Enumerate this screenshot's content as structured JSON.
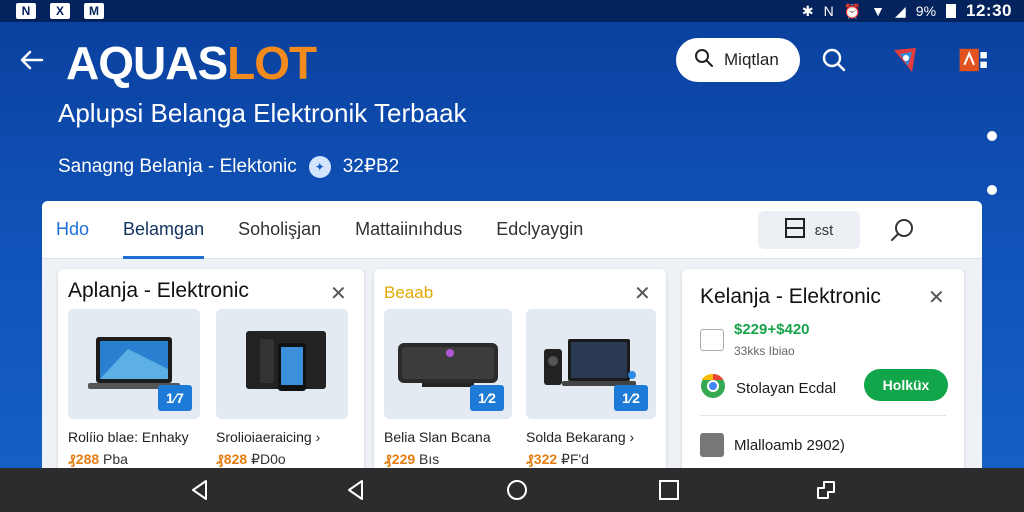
{
  "status_bar": {
    "left_icons": [
      "N",
      "X",
      "M"
    ],
    "battery": "9%",
    "time": "12:30"
  },
  "header": {
    "logo_part1": "AQUAS",
    "logo_part2": "LOT",
    "search_label": "Miqtlan",
    "headline": "Aplupsi Belanga Elektronik Terbaak",
    "subline": "Sanagng Belanja - Elektonic",
    "sub_badge_text": "32₽B2"
  },
  "tabs": {
    "items": [
      "Hdo",
      "Belamgan",
      "Soholişjan",
      "Mattaiinıhdus",
      "Edclyaygin"
    ],
    "filter_label": "ɛst"
  },
  "card1": {
    "title": "Aplanja - Elektronic",
    "products": [
      {
        "name": "Rolíio blae: Enhaky",
        "price": "₰288",
        "unit": "Pba",
        "qty": "1⁄7"
      },
      {
        "name": "Srolioiaeraicing",
        "price": "₰828",
        "unit": "₽D0o",
        "qty": ""
      }
    ]
  },
  "card2": {
    "title": "Beaab",
    "products": [
      {
        "name": "Belia Slan Bcana",
        "price": "₰229",
        "unit": "Bıs",
        "qty": "1⁄2"
      },
      {
        "name": "Solda Bekarang",
        "price": "₰322",
        "unit": "₽F'd",
        "qty": "1⁄2"
      }
    ]
  },
  "card3": {
    "title": "Kelanja - Elektronic",
    "price": "$229+$420",
    "price_sub": "33kks Ibiao",
    "seller": "Stolayan Ecdal",
    "button": "Holküx",
    "footer": "Mlalloamb 2902)"
  },
  "colors": {
    "brand_orange": "#f28b1e",
    "accent_blue": "#1d6fd6",
    "green": "#12a64a"
  }
}
